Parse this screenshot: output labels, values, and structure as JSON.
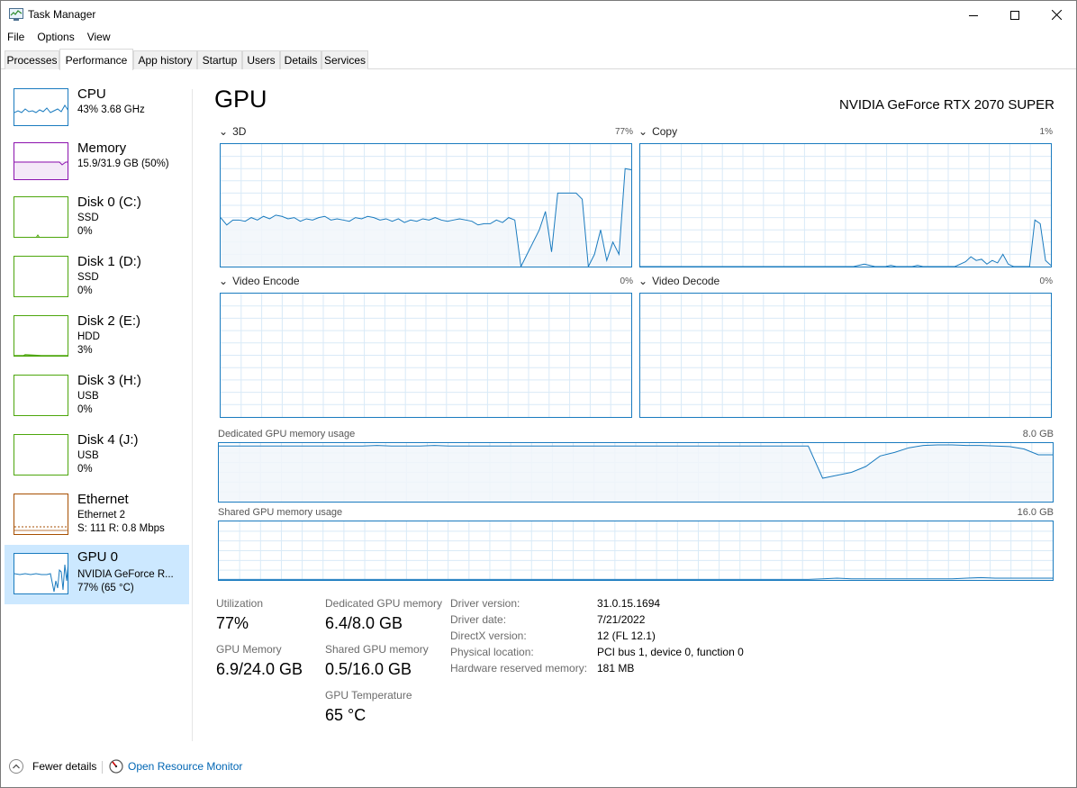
{
  "window": {
    "title": "Task Manager"
  },
  "menu": [
    "File",
    "Options",
    "View"
  ],
  "tabs": [
    "Processes",
    "Performance",
    "App history",
    "Startup",
    "Users",
    "Details",
    "Services"
  ],
  "active_tab": "Performance",
  "sidebar": {
    "items": [
      {
        "name": "CPU",
        "line1": "43%  3.68 GHz",
        "line2": "",
        "color": "#1a7bbf",
        "icon": "cpu-thumbnail"
      },
      {
        "name": "Memory",
        "line1": "15.9/31.9 GB (50%)",
        "line2": "",
        "color": "#8b12ae",
        "icon": "memory-thumbnail"
      },
      {
        "name": "Disk 0 (C:)",
        "line1": "SSD",
        "line2": "0%",
        "color": "#4da60c",
        "icon": "disk-thumbnail"
      },
      {
        "name": "Disk 1 (D:)",
        "line1": "SSD",
        "line2": "0%",
        "color": "#4da60c",
        "icon": "disk-thumbnail"
      },
      {
        "name": "Disk 2 (E:)",
        "line1": "HDD",
        "line2": "3%",
        "color": "#4da60c",
        "icon": "disk-thumbnail"
      },
      {
        "name": "Disk 3 (H:)",
        "line1": "USB",
        "line2": "0%",
        "color": "#4da60c",
        "icon": "disk-thumbnail"
      },
      {
        "name": "Disk 4 (J:)",
        "line1": "USB",
        "line2": "0%",
        "color": "#4da60c",
        "icon": "disk-thumbnail"
      },
      {
        "name": "Ethernet",
        "line1": "Ethernet 2",
        "line2": "S: 111  R: 0.8 Mbps",
        "color": "#a74f01",
        "icon": "ethernet-thumbnail"
      },
      {
        "name": "GPU 0",
        "line1": "NVIDIA GeForce R...",
        "line2": "77% (65 °C)",
        "color": "#1a7bbf",
        "icon": "gpu-thumbnail"
      }
    ],
    "selected": "GPU 0"
  },
  "main": {
    "title": "GPU",
    "model": "NVIDIA GeForce RTX 2070 SUPER",
    "engines": [
      {
        "name": "3D",
        "pct": "77%"
      },
      {
        "name": "Copy",
        "pct": "1%"
      },
      {
        "name": "Video Encode",
        "pct": "0%"
      },
      {
        "name": "Video Decode",
        "pct": "0%"
      }
    ],
    "dedicated_label": "Dedicated GPU memory usage",
    "dedicated_max": "8.0 GB",
    "shared_label": "Shared GPU memory usage",
    "shared_max": "16.0 GB"
  },
  "stats": {
    "utilization_label": "Utilization",
    "utilization": "77%",
    "dedicated_label": "Dedicated GPU memory",
    "dedicated": "6.4/8.0 GB",
    "gpu_memory_label": "GPU Memory",
    "gpu_memory": "6.9/24.0 GB",
    "shared_label": "Shared GPU memory",
    "shared": "0.5/16.0 GB",
    "temp_label": "GPU Temperature",
    "temp": "65 °C"
  },
  "details": [
    {
      "key": "Driver version:",
      "value": "31.0.15.1694"
    },
    {
      "key": "Driver date:",
      "value": "7/21/2022"
    },
    {
      "key": "DirectX version:",
      "value": "12 (FL 12.1)"
    },
    {
      "key": "Physical location:",
      "value": "PCI bus 1, device 0, function 0"
    },
    {
      "key": "Hardware reserved memory:",
      "value": "181 MB"
    }
  ],
  "footer": {
    "fewer_details": "Fewer details",
    "resource_monitor": "Open Resource Monitor"
  },
  "colors": {
    "gpu_line": "#1a7bbf",
    "gpu_fill": "#f1f6fa",
    "grid": "#d9eaf7",
    "selected_bg": "#cce8ff",
    "link": "#0066b4"
  },
  "graph_series": {
    "three_d": [
      0.4,
      0.34,
      0.38,
      0.38,
      0.37,
      0.4,
      0.38,
      0.41,
      0.39,
      0.42,
      0.41,
      0.39,
      0.4,
      0.37,
      0.39,
      0.38,
      0.4,
      0.41,
      0.38,
      0.39,
      0.38,
      0.37,
      0.4,
      0.39,
      0.41,
      0.4,
      0.38,
      0.39,
      0.37,
      0.39,
      0.36,
      0.38,
      0.37,
      0.39,
      0.38,
      0.4,
      0.38,
      0.37,
      0.38,
      0.39,
      0.38,
      0.37,
      0.34,
      0.35,
      0.35,
      0.38,
      0.36,
      0.4,
      0.38,
      0.0,
      0.1,
      0.2,
      0.3,
      0.45,
      0.12,
      0.6,
      0.6,
      0.6,
      0.6,
      0.55,
      0.0,
      0.1,
      0.3,
      0.05,
      0.2,
      0.1,
      0.8,
      0.79
    ],
    "copy": [
      0,
      0,
      0,
      0,
      0,
      0,
      0,
      0,
      0,
      0,
      0,
      0,
      0,
      0,
      0,
      0,
      0,
      0,
      0,
      0,
      0,
      0,
      0,
      0,
      0,
      0,
      0,
      0,
      0,
      0,
      0,
      0,
      0,
      0,
      0,
      0,
      0,
      0,
      0,
      0,
      0,
      0.01,
      0.02,
      0.01,
      0,
      0,
      0,
      0.01,
      0,
      0,
      0,
      0,
      0.01,
      0,
      0,
      0,
      0,
      0,
      0,
      0,
      0.02,
      0.04,
      0.08,
      0.05,
      0.06,
      0.02,
      0.05,
      0.03,
      0.1,
      0.02,
      0,
      0,
      0,
      0,
      0.38,
      0.35,
      0.05,
      0.01
    ],
    "dedicated": [
      0.95,
      0.95,
      0.95,
      0.95,
      0.95,
      0.95,
      0.95,
      0.95,
      0.95,
      0.95,
      0.95,
      0.96,
      0.95,
      0.95,
      0.95,
      0.96,
      0.95,
      0.95,
      0.95,
      0.95,
      0.95,
      0.95,
      0.95,
      0.95,
      0.95,
      0.95,
      0.95,
      0.95,
      0.95,
      0.95,
      0.95,
      0.95,
      0.95,
      0.95,
      0.95,
      0.95,
      0.95,
      0.95,
      0.95,
      0.95,
      0.95,
      0.95,
      0.4,
      0.45,
      0.5,
      0.6,
      0.78,
      0.84,
      0.92,
      0.96,
      0.97,
      0.97,
      0.96,
      0.96,
      0.95,
      0.94,
      0.9,
      0.8,
      0.8
    ],
    "shared": [
      0.01,
      0.01,
      0.01,
      0.01,
      0.01,
      0.01,
      0.01,
      0.01,
      0.01,
      0.01,
      0.01,
      0.01,
      0.01,
      0.01,
      0.01,
      0.01,
      0.01,
      0.01,
      0.01,
      0.01,
      0.01,
      0.01,
      0.01,
      0.01,
      0.01,
      0.01,
      0.01,
      0.01,
      0.01,
      0.01,
      0.01,
      0.01,
      0.01,
      0.01,
      0.01,
      0.01,
      0.01,
      0.01,
      0.01,
      0.01,
      0.01,
      0.01,
      0.02,
      0.03,
      0.02,
      0.02,
      0.02,
      0.02,
      0.02,
      0.02,
      0.02,
      0.02,
      0.03,
      0.04,
      0.03,
      0.03,
      0.03,
      0.03,
      0.03
    ]
  }
}
